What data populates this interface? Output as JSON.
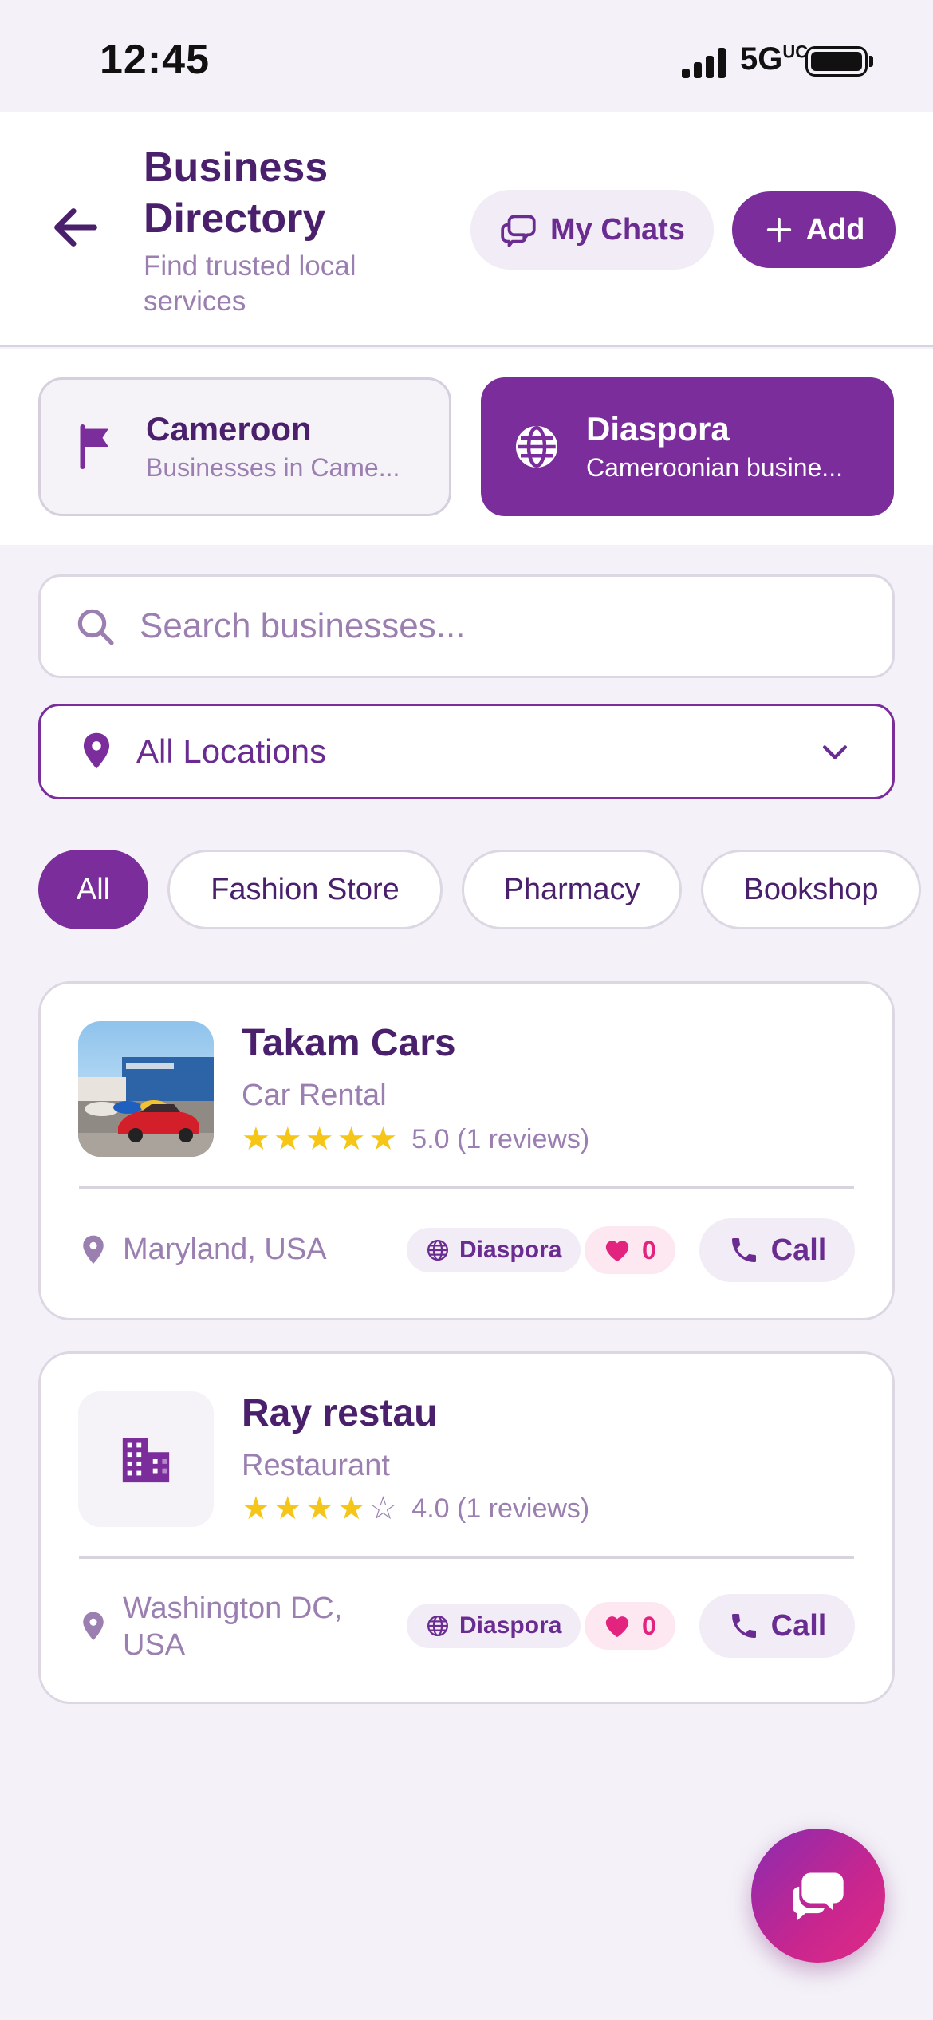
{
  "status_bar": {
    "time": "12:45",
    "network": "5G",
    "network_sup": "UC"
  },
  "header": {
    "title": "Business Directory",
    "subtitle": "Find trusted local services",
    "my_chats_label": "My Chats",
    "add_label": "Add"
  },
  "tabs": [
    {
      "title": "Cameroon",
      "subtitle": "Businesses in Came...",
      "icon": "flag-icon",
      "active": false
    },
    {
      "title": "Diaspora",
      "subtitle": "Cameroonian busine...",
      "icon": "globe-icon",
      "active": true
    }
  ],
  "search": {
    "placeholder": "Search businesses..."
  },
  "location_filter": {
    "value": "All Locations"
  },
  "categories": [
    "All",
    "Fashion Store",
    "Pharmacy",
    "Bookshop"
  ],
  "businesses": [
    {
      "name": "Takam Cars",
      "category": "Car Rental",
      "rating": 5.0,
      "stars_filled": 5,
      "rating_text": "5.0 (1 reviews)",
      "location": "Maryland, USA",
      "badge": "Diaspora",
      "likes": "0",
      "call_label": "Call",
      "thumbnail": "photo"
    },
    {
      "name": "Ray restau",
      "category": "Restaurant",
      "rating": 4.0,
      "stars_filled": 4,
      "rating_text": "4.0 (1 reviews)",
      "location": "Washington DC, USA",
      "badge": "Diaspora",
      "likes": "0",
      "call_label": "Call",
      "thumbnail": "building-icon"
    }
  ],
  "colors": {
    "primary": "#7a2d9b",
    "text_dark": "#4a1f6b",
    "text_muted": "#9a7fb0",
    "star": "#f5c518",
    "like": "#e2247f",
    "fab_gradient_end": "#e02a85"
  }
}
